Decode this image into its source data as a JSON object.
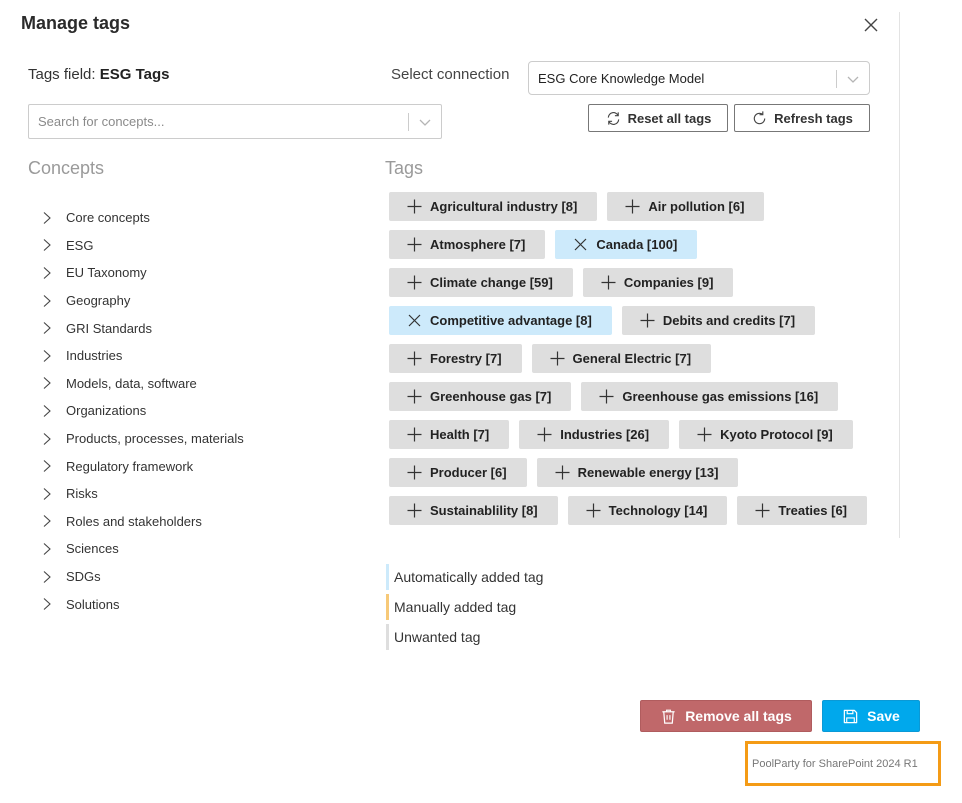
{
  "dialog": {
    "title": "Manage tags",
    "close_icon": "close-icon"
  },
  "tags_field": {
    "label": "Tags field:",
    "value": "ESG Tags"
  },
  "search": {
    "placeholder": "Search for concepts...",
    "value": ""
  },
  "connection": {
    "label": "Select connection",
    "selected": "ESG Core Knowledge Model"
  },
  "toolbar": {
    "reset_label": "Reset all tags",
    "refresh_label": "Refresh tags"
  },
  "concepts": {
    "heading": "Concepts",
    "items": [
      "Core concepts",
      "ESG",
      "EU Taxonomy",
      "Geography",
      "GRI Standards",
      "Industries",
      "Models, data, software",
      "Organizations",
      "Products, processes, materials",
      "Regulatory framework",
      "Risks",
      "Roles and stakeholders",
      "Sciences",
      "SDGs",
      "Solutions"
    ]
  },
  "tags": {
    "heading": "Tags",
    "rows": [
      [
        {
          "label": "Agricultural industry [8]",
          "state": "unwanted"
        },
        {
          "label": "Air pollution [6]",
          "state": "unwanted"
        }
      ],
      [
        {
          "label": "Atmosphere [7]",
          "state": "unwanted"
        },
        {
          "label": "Canada [100]",
          "state": "auto"
        }
      ],
      [
        {
          "label": "Climate change [59]",
          "state": "unwanted"
        },
        {
          "label": "Companies [9]",
          "state": "unwanted"
        }
      ],
      [
        {
          "label": "Competitive advantage [8]",
          "state": "auto"
        },
        {
          "label": "Debits and credits [7]",
          "state": "unwanted"
        }
      ],
      [
        {
          "label": "Forestry [7]",
          "state": "unwanted"
        },
        {
          "label": "General Electric [7]",
          "state": "unwanted"
        }
      ],
      [
        {
          "label": "Greenhouse gas [7]",
          "state": "unwanted"
        },
        {
          "label": "Greenhouse gas emissions [16]",
          "state": "unwanted"
        }
      ],
      [
        {
          "label": "Health [7]",
          "state": "unwanted"
        },
        {
          "label": "Industries [26]",
          "state": "unwanted"
        },
        {
          "label": "Kyoto Protocol [9]",
          "state": "unwanted"
        }
      ],
      [
        {
          "label": "Producer [6]",
          "state": "unwanted"
        },
        {
          "label": "Renewable energy [13]",
          "state": "unwanted"
        }
      ],
      [
        {
          "label": "Sustainablility [8]",
          "state": "unwanted"
        },
        {
          "label": "Technology [14]",
          "state": "unwanted"
        },
        {
          "label": "Treaties [6]",
          "state": "unwanted"
        }
      ]
    ]
  },
  "legend": [
    {
      "label": "Automatically added tag",
      "color": "#cdeafb"
    },
    {
      "label": "Manually added tag",
      "color": "#f7c978"
    },
    {
      "label": "Unwanted tag",
      "color": "#dedede"
    }
  ],
  "actions": {
    "remove_all_label": "Remove all tags",
    "save_label": "Save"
  },
  "footer": {
    "version": "PoolParty for SharePoint 2024 R1"
  },
  "colors": {
    "auto_tag": "#cdeafb",
    "unwanted_tag": "#dedede",
    "manual_tag": "#f7c978",
    "danger": "#c0686a",
    "primary": "#00a8ec",
    "highlight_border": "#f49b16"
  }
}
